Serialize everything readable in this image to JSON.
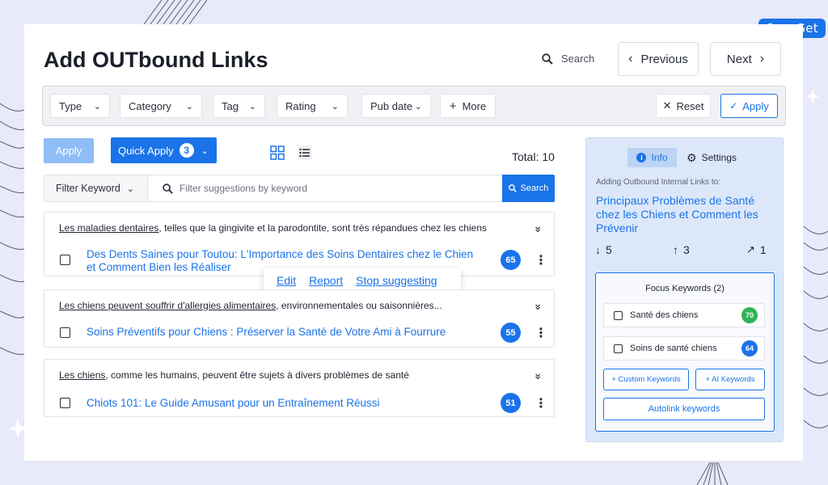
{
  "brand": {
    "logo_text": "SaasGet"
  },
  "header": {
    "title": "Add OUTbound Links",
    "search_label": "Search",
    "previous_label": "Previous",
    "next_label": "Next"
  },
  "filters": {
    "type": "Type",
    "category": "Category",
    "tag": "Tag",
    "rating": "Rating",
    "pub_date": "Pub date",
    "more": "More",
    "reset": "Reset",
    "apply": "Apply"
  },
  "toolbar": {
    "apply_label": "Apply",
    "quick_apply_label": "Quick Apply",
    "quick_apply_count": "3",
    "total_label": "Total: 10"
  },
  "keyword_filter": {
    "select_label": "Filter Keyword",
    "placeholder": "Filter suggestions by keyword",
    "search_label": "Search"
  },
  "suggestions": [
    {
      "anchor": "Les maladies dentaires",
      "context": ", telles que la gingivite et la parodontite, sont très répandues chez les chiens",
      "link_title": "Des Dents Saines pour Toutou: L'Importance des Soins Dentaires chez le Chien et Comment Bien les Réaliser",
      "score": "65"
    },
    {
      "anchor": "Les chiens peuvent souffrir d'allergies alimentaires",
      "context": ", environnementales ou saisonnières...",
      "link_title": "Soins Préventifs pour Chiens : Préserver la Santé de Votre Ami à Fourrure",
      "score": "55"
    },
    {
      "anchor": "Les chiens",
      "context": ", comme les humains, peuvent être sujets à divers problèmes de santé",
      "link_title": "Chiots 101: Le Guide Amusant pour un Entraînement Réussi",
      "score": "51"
    }
  ],
  "popover": {
    "edit": "Edit",
    "report": "Report",
    "stop": "Stop suggesting"
  },
  "panel": {
    "tab_info": "Info",
    "tab_settings": "Settings",
    "label": "Adding Outbound Internal Links to:",
    "target_title": "Principaux Problèmes de Santé chez les Chiens et Comment les Prévenir",
    "stat_in": "5",
    "stat_out": "3",
    "stat_ext": "1",
    "focus_title": "Focus Keywords (2)",
    "keywords": [
      {
        "label": "Santé des chiens",
        "score": "70",
        "color": "#2fb457"
      },
      {
        "label": "Soins de santé chiens",
        "score": "64",
        "color": "#1a73e8"
      }
    ],
    "custom_keywords": "+ Custom Keywords",
    "ai_keywords": "+ AI Keywords",
    "autolink": "Autolink keywords"
  },
  "colors": {
    "accent": "#1a73e8",
    "background": "#e8e9fb"
  }
}
